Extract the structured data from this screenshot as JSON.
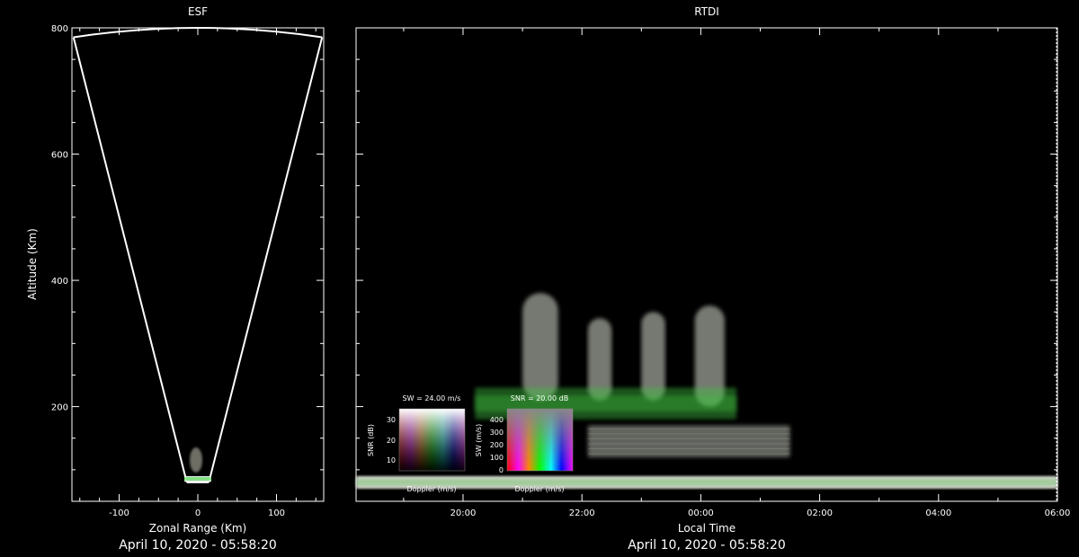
{
  "colors": {
    "background": "#000000",
    "axes": "#ffffff",
    "echo_green": "#3fbf3f",
    "echo_white": "#d8ddd0"
  },
  "chart_data": [
    {
      "type": "heatmap",
      "title": "ESF",
      "xlabel": "Zonal Range (Km)",
      "ylabel": "Altitude (Km)",
      "xlim": [
        -160,
        160
      ],
      "ylim": [
        50,
        800
      ],
      "x_ticks": [
        -100,
        0,
        100
      ],
      "y_ticks": [
        200,
        400,
        600,
        800
      ],
      "fan_beam": {
        "apex_altitude": 0,
        "edge_range_at_top": 160
      },
      "date_label": "April 10, 2020 - 05:58:20"
    },
    {
      "type": "heatmap",
      "title": "RTDI",
      "xlabel": "Local Time",
      "ylabel": "",
      "ylim": [
        50,
        800
      ],
      "x_ticks": [
        "20:00",
        "22:00",
        "00:00",
        "02:00",
        "04:00",
        "06:00"
      ],
      "x_tick_positions_hours": [
        20,
        22,
        24,
        26,
        28,
        30
      ],
      "xlim_hours": [
        18.2,
        30
      ],
      "date_label": "April 10, 2020 - 05:58:20",
      "echo_features": [
        {
          "start": 21.0,
          "end": 21.6,
          "bottom": 210,
          "top": 380,
          "color": "white"
        },
        {
          "start": 22.1,
          "end": 22.5,
          "bottom": 210,
          "top": 340,
          "color": "white"
        },
        {
          "start": 23.0,
          "end": 23.4,
          "bottom": 210,
          "top": 350,
          "color": "white"
        },
        {
          "start": 23.9,
          "end": 24.4,
          "bottom": 200,
          "top": 360,
          "color": "white"
        },
        {
          "start": 20.2,
          "end": 24.6,
          "bottom": 180,
          "top": 230,
          "color": "green"
        },
        {
          "start": 22.1,
          "end": 25.5,
          "bottom": 120,
          "top": 170,
          "color": "white"
        },
        {
          "start": 18.2,
          "end": 30.0,
          "bottom": 70,
          "top": 90,
          "color": "white"
        }
      ]
    }
  ],
  "legends": {
    "sw": {
      "title": "SW = 24.00 m/s",
      "ylabel": "SNR (dB)",
      "xlabel": "Doppler (m/s)",
      "y_ticks": [
        "30",
        "20",
        "10"
      ]
    },
    "snr": {
      "title": "SNR = 20.00 dB",
      "ylabel": "SW (m/s)",
      "xlabel": "Doppler (m/s)",
      "y_ticks": [
        "400",
        "300",
        "200",
        "100",
        "0"
      ]
    }
  }
}
